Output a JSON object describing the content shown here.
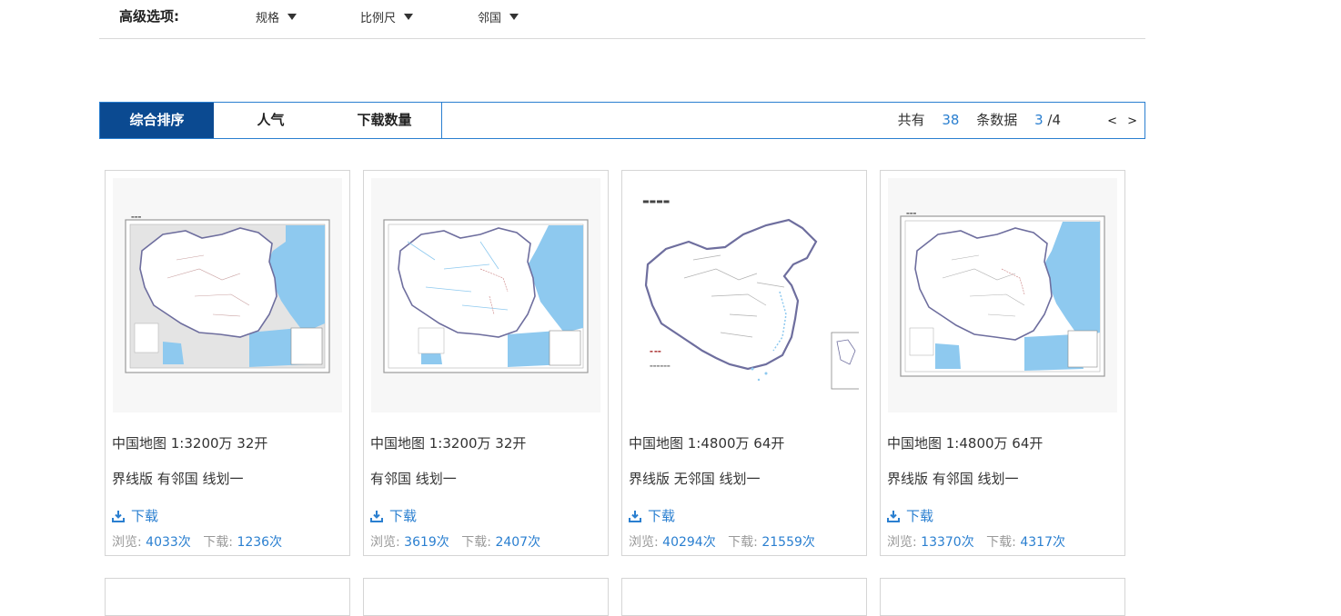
{
  "advanced": {
    "label": "高级选项:",
    "options": [
      {
        "label": "规格"
      },
      {
        "label": "比例尺"
      },
      {
        "label": "邻国"
      }
    ]
  },
  "sort": {
    "tabs": [
      {
        "label": "综合排序",
        "active": true
      },
      {
        "label": "人气",
        "active": false
      },
      {
        "label": "下载数量",
        "active": false
      }
    ],
    "count_prefix": "共有",
    "count_value": "38",
    "count_suffix": "条数据",
    "page_current": "3",
    "page_total": "/4",
    "prev_label": "<",
    "next_label": ">"
  },
  "cards": [
    {
      "title": "中国地图 1:3200万 32开",
      "tags": "界线版 有邻国 线划一",
      "download_label": "下载",
      "views_label": "浏览:",
      "views": "4033次",
      "downloads_label": "下载:",
      "downloads": "1236次"
    },
    {
      "title": "中国地图 1:3200万 32开",
      "tags": "有邻国 线划一",
      "download_label": "下载",
      "views_label": "浏览:",
      "views": "3619次",
      "downloads_label": "下载:",
      "downloads": "2407次"
    },
    {
      "title": "中国地图 1:4800万 64开",
      "tags": "界线版 无邻国 线划一",
      "download_label": "下载",
      "views_label": "浏览:",
      "views": "40294次",
      "downloads_label": "下载:",
      "downloads": "21559次"
    },
    {
      "title": "中国地图 1:4800万 64开",
      "tags": "界线版 有邻国 线划一",
      "download_label": "下载",
      "views_label": "浏览:",
      "views": "13370次",
      "downloads_label": "下载:",
      "downloads": "4317次"
    }
  ],
  "icons": {
    "dropdown": "caret-down-icon",
    "download": "download-icon"
  },
  "colors": {
    "accent": "#2a7fd0",
    "active_tab": "#0b4a91",
    "sea": "#8ec9ef"
  }
}
